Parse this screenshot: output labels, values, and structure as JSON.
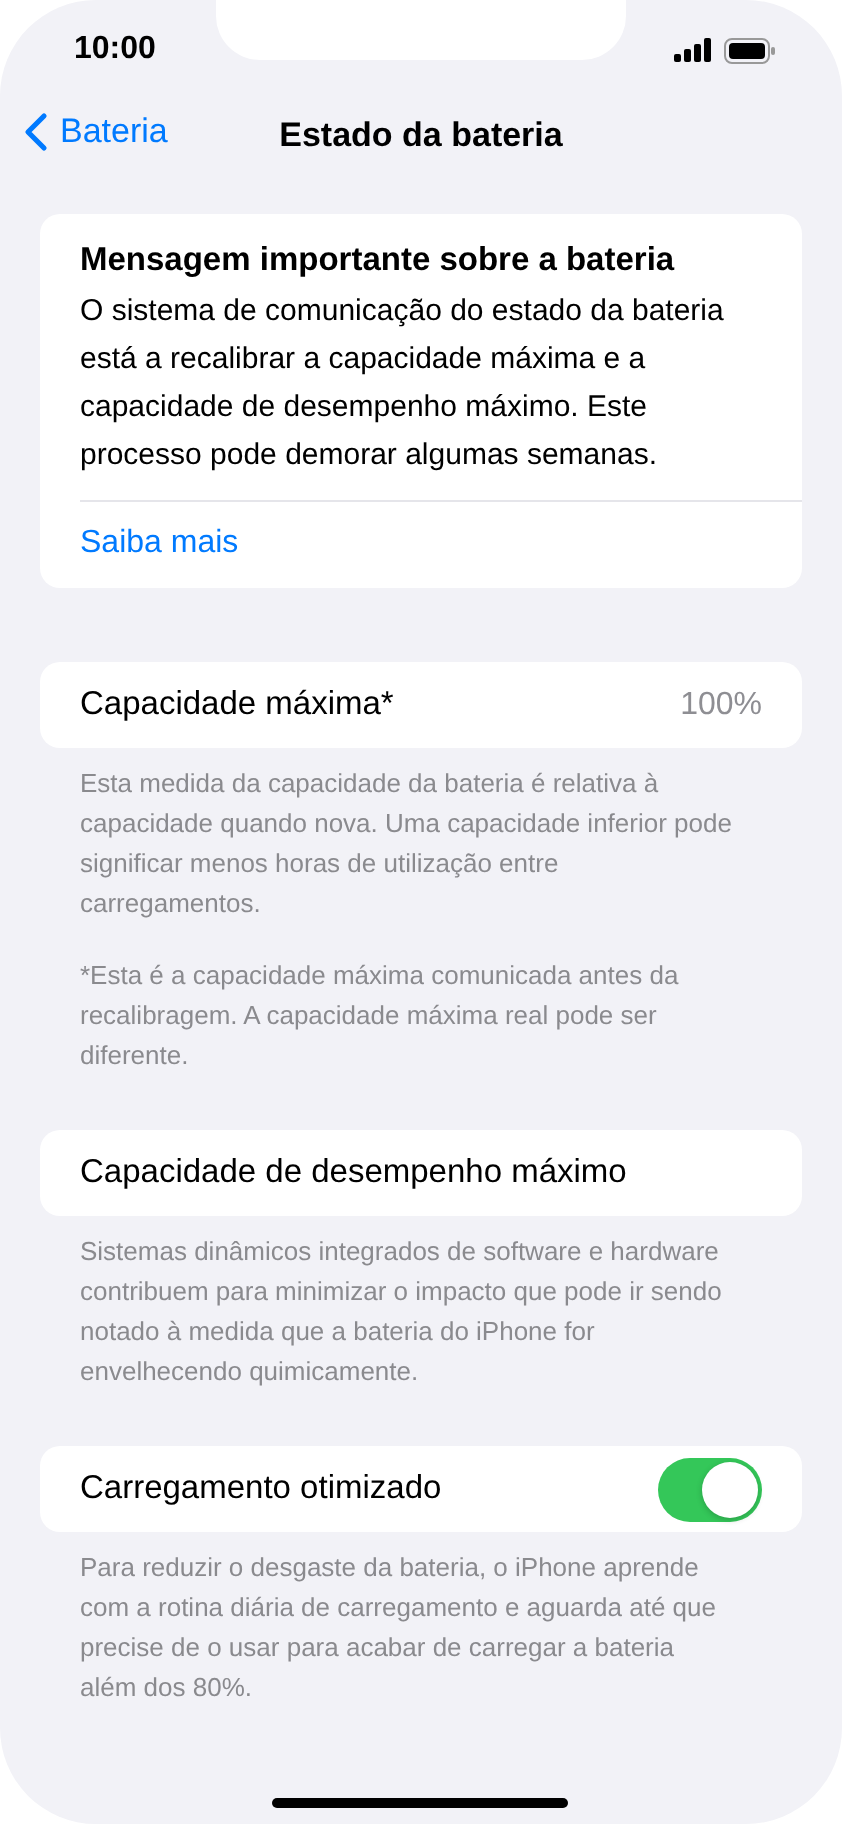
{
  "status_bar": {
    "time": "10:00"
  },
  "nav": {
    "back": "Bateria",
    "title": "Estado da bateria"
  },
  "notice": {
    "title": "Mensagem importante sobre a bateria",
    "body": "O sistema de comunicação do estado da bateria está a recalibrar a capacidade máxima e a capacidade de desempenho máximo. Este processo pode demorar algumas semanas.",
    "link": "Saiba mais"
  },
  "sections": [
    {
      "kind": "value",
      "label": "Capacidade máxima*",
      "value": "100%",
      "footers": [
        "Esta medida da capacidade da bateria é relativa à capacidade quando nova. Uma capacidade inferior pode significar menos horas de utilização entre carregamentos.",
        "*Esta é a capacidade máxima comunicada antes da recalibragem. A capacidade máxima real pode ser diferente."
      ]
    },
    {
      "kind": "plain",
      "label": "Capacidade de desempenho máximo",
      "footers": [
        "Sistemas dinâmicos integrados de software e hardware contribuem para minimizar o impacto que pode ir sendo notado à medida que a bateria do iPhone for envelhecendo quimicamente."
      ]
    },
    {
      "kind": "toggle",
      "label": "Carregamento otimizado",
      "on": true,
      "footers": [
        "Para reduzir o desgaste da bateria, o iPhone aprende com a rotina diária de carregamento e aguarda até que precise de o usar para acabar de carregar a bateria além dos 80%."
      ]
    }
  ]
}
